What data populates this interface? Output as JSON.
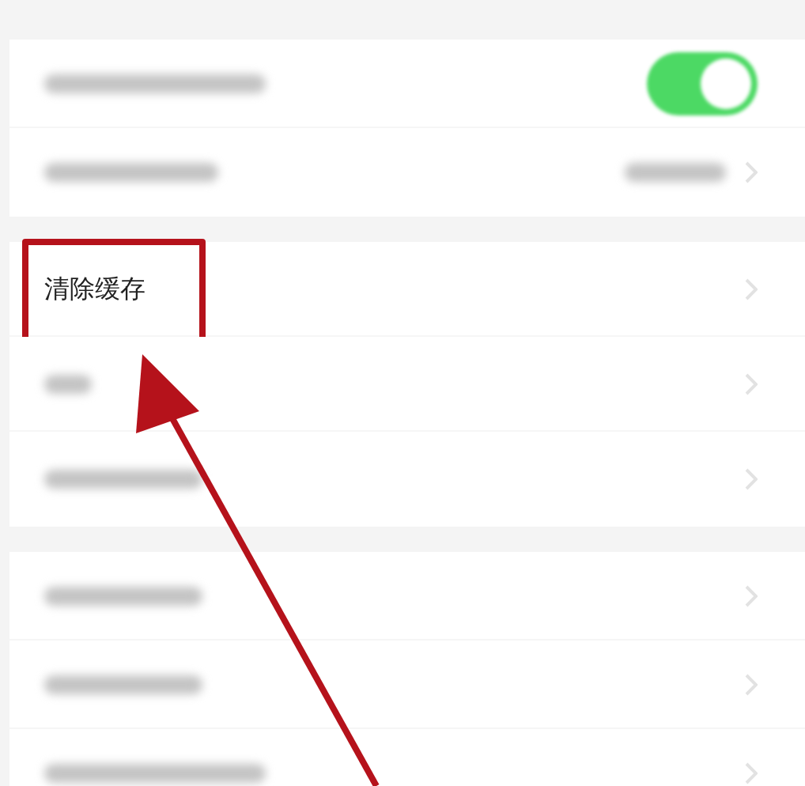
{
  "sections": [
    {
      "rows": [
        {
          "kind": "toggle",
          "on": true,
          "highlighted": false
        },
        {
          "kind": "value",
          "highlighted": false
        }
      ]
    },
    {
      "rows": [
        {
          "kind": "link",
          "label": "清除缓存",
          "highlighted": true
        },
        {
          "kind": "blurred",
          "highlighted": false
        },
        {
          "kind": "blurred",
          "highlighted": false
        }
      ]
    },
    {
      "rows": [
        {
          "kind": "blurred",
          "highlighted": false
        },
        {
          "kind": "blurred",
          "highlighted": false
        },
        {
          "kind": "blurred",
          "highlighted": false
        }
      ]
    }
  ]
}
